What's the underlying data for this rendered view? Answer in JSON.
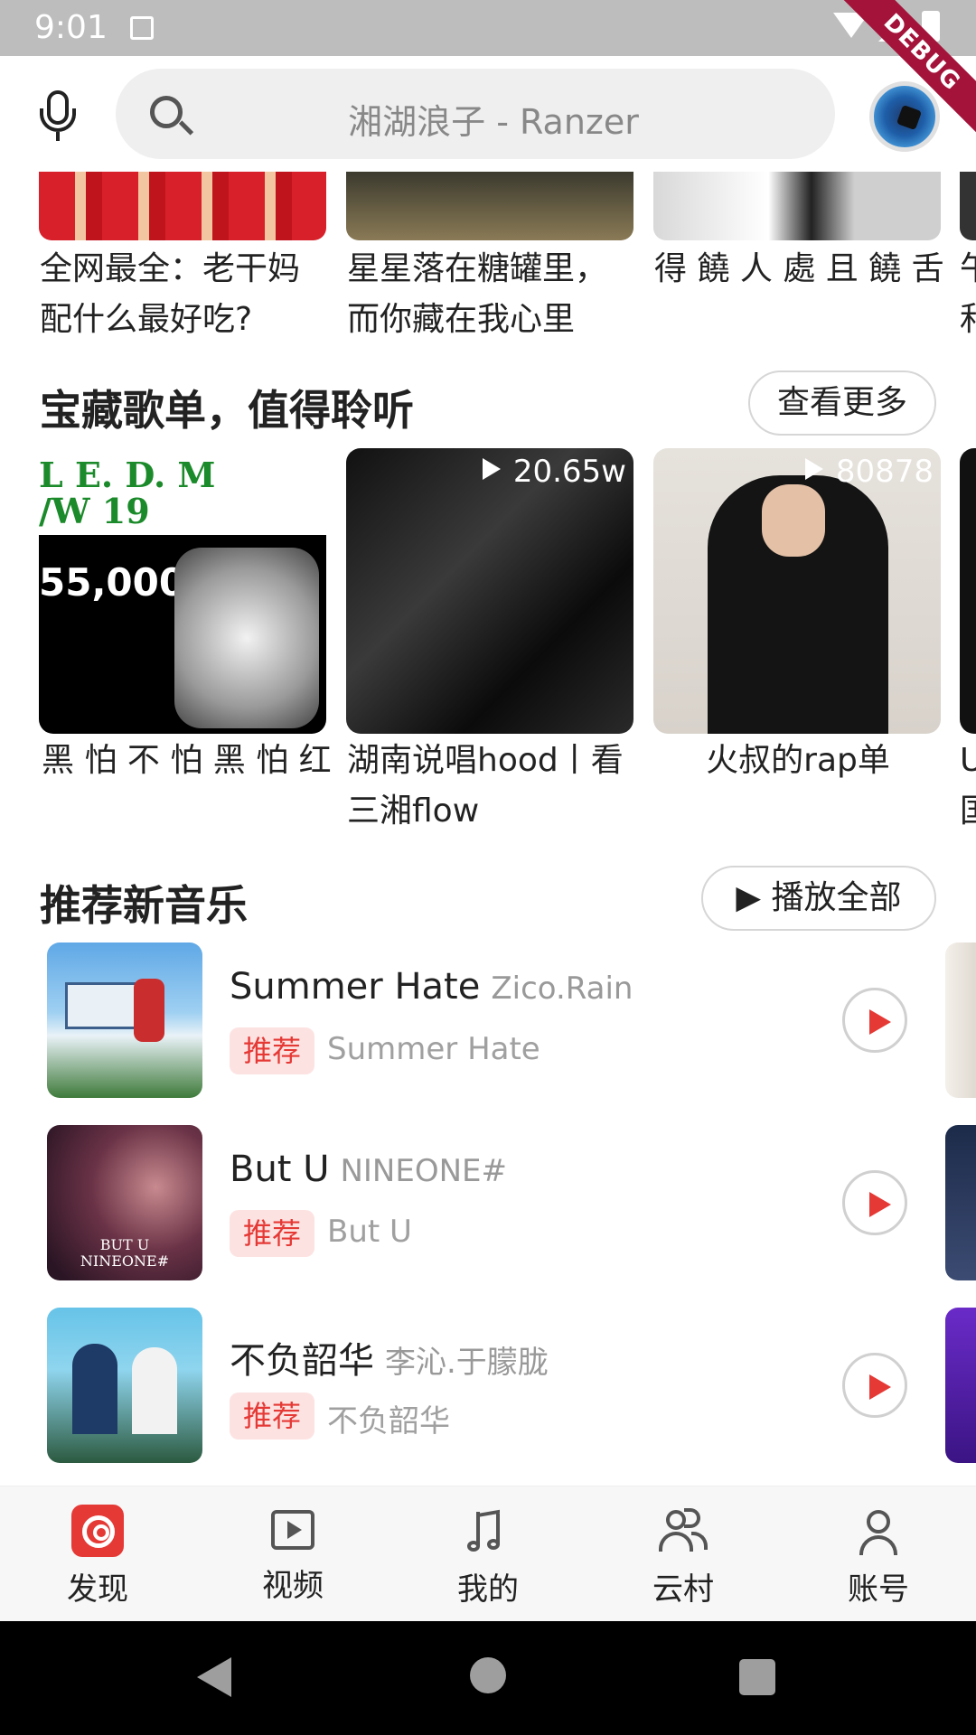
{
  "status_bar": {
    "time": "9:01",
    "debug_label": "DEBUG"
  },
  "header": {
    "search_placeholder": "湘湖浪子 - Ranzer"
  },
  "top_cards": [
    {
      "line1": "全网最全：老干妈",
      "line2": "配什么最好吃?"
    },
    {
      "line1": "星星落在糖罐里，",
      "line2": "而你藏在我心里"
    },
    {
      "line1": "得 饒 人 處 且 饒 舌",
      "line2": ""
    },
    {
      "line1": "午",
      "line2": "和"
    }
  ],
  "playlist_section": {
    "title": "宝藏歌单，值得聆听",
    "more_button": "查看更多",
    "items": [
      {
        "plays": "",
        "line1": "黑 怕 不 怕 黑 怕 红",
        "line2": ""
      },
      {
        "plays": "20.65w",
        "line1": "湖南说唱hood丨看",
        "line2": "三湘flow"
      },
      {
        "plays": "80878",
        "line1": "火叔的rap单",
        "line2": ""
      },
      {
        "plays": "",
        "line1": "U",
        "line2": "国"
      }
    ]
  },
  "new_music": {
    "title": "推荐新音乐",
    "play_all_button": "▶ 播放全部",
    "songs": [
      {
        "title": "Summer Hate",
        "artist": "Zico.Rain",
        "tag": "推荐",
        "subtitle": "Summer Hate"
      },
      {
        "title": "But U",
        "artist": "NINEONE#",
        "tag": "推荐",
        "subtitle": "But U"
      },
      {
        "title": "不负韶华",
        "artist": "李沁.于朦胧",
        "tag": "推荐",
        "subtitle": "不负韶华"
      }
    ]
  },
  "bottom_nav": [
    {
      "label": "发现",
      "icon": "discover-icon",
      "active": true
    },
    {
      "label": "视频",
      "icon": "video-icon"
    },
    {
      "label": "我的",
      "icon": "music-note-icon"
    },
    {
      "label": "云村",
      "icon": "people-icon"
    },
    {
      "label": "账号",
      "icon": "user-icon"
    }
  ],
  "colors": {
    "accent": "#e53935",
    "tag_bg": "#fde2e2"
  }
}
